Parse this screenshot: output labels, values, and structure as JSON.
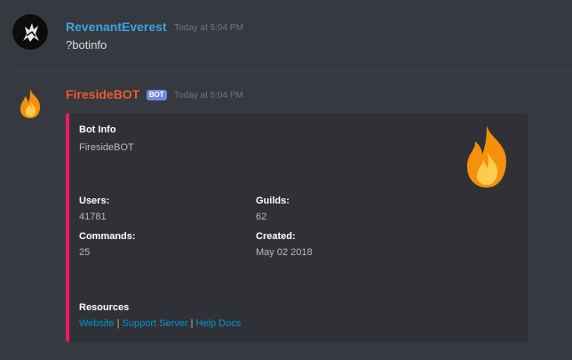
{
  "message1": {
    "username": "RevenantEverest",
    "timestamp": "Today at 5:04 PM",
    "content": "?botinfo",
    "name_color": "#3ea2e3"
  },
  "message2": {
    "username": "FiresideBOT",
    "bot_tag": "BOT",
    "timestamp": "Today at 5:04 PM",
    "name_color": "#ee5a2a",
    "embed": {
      "accent_color": "#ec1a5e",
      "title": "Bot Info",
      "description": "FiresideBOT",
      "thumbnail_icon": "fire-icon",
      "fields": {
        "users": {
          "name": "Users:",
          "value": "41781"
        },
        "guilds": {
          "name": "Guilds:",
          "value": "62"
        },
        "commands": {
          "name": "Commands:",
          "value": "25"
        },
        "created": {
          "name": "Created:",
          "value": "May 02 2018"
        }
      },
      "resources": {
        "name": "Resources",
        "links": [
          {
            "label": "Website"
          },
          {
            "label": "Support Server"
          },
          {
            "label": "Help Docs"
          }
        ],
        "separator": "|"
      }
    }
  }
}
